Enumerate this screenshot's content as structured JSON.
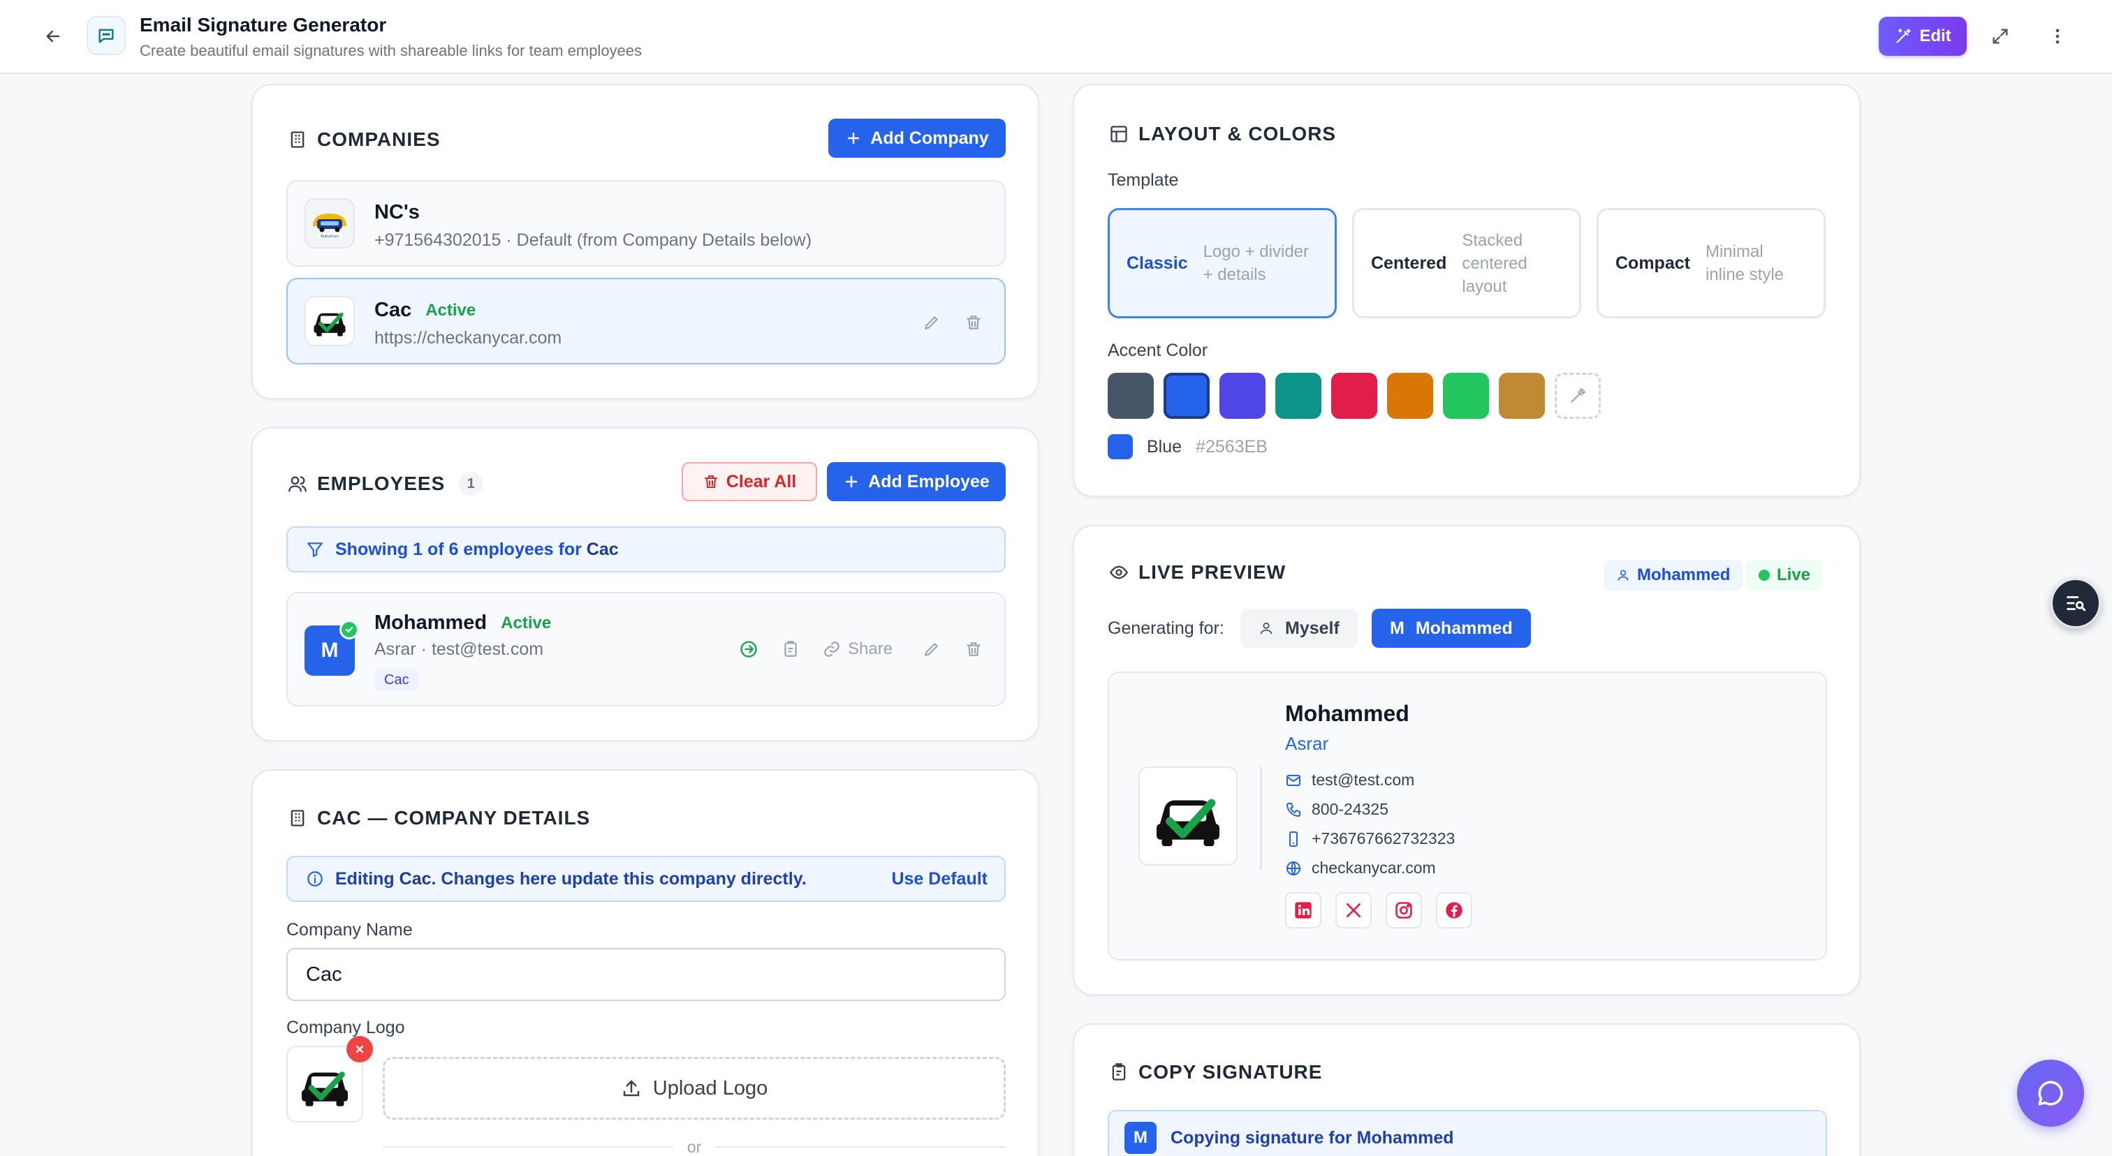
{
  "app": {
    "title": "Email Signature Generator",
    "subtitle": "Create beautiful email signatures with shareable links for team employees",
    "edit_label": "Edit"
  },
  "companies": {
    "title": "COMPANIES",
    "add_label": "Add Company",
    "items": [
      {
        "name": "NC's",
        "detail": "+971564302015 · Default (from Company Details below)",
        "logo_text": "NubiaCars"
      },
      {
        "name": "Cac",
        "status": "Active",
        "detail": "https://checkanycar.com"
      }
    ]
  },
  "employees": {
    "title": "EMPLOYEES",
    "count": "1",
    "clear_label": "Clear All",
    "add_label": "Add Employee",
    "filter_prefix": "Showing 1 of 6 employees for ",
    "filter_company": "Cac",
    "items": [
      {
        "initial": "M",
        "name": "Mohammed",
        "status": "Active",
        "detail": "Asrar · test@test.com",
        "tag": "Cac",
        "share_label": "Share"
      }
    ]
  },
  "company_details": {
    "title": "CAC — COMPANY DETAILS",
    "info_prefix": "Editing ",
    "info_company": "Cac",
    "info_suffix": ". Changes here update this company directly.",
    "use_default": "Use Default",
    "name_label": "Company Name",
    "name_value": "Cac",
    "logo_label": "Company Logo",
    "upload_label": "Upload Logo",
    "or_label": "or"
  },
  "layout": {
    "title": "LAYOUT & COLORS",
    "template_label": "Template",
    "templates": [
      {
        "name": "Classic",
        "desc1": "Logo + divider",
        "desc2": "+ details",
        "desc3": ""
      },
      {
        "name": "Centered",
        "desc1": "Stacked",
        "desc2": "centered",
        "desc3": "layout"
      },
      {
        "name": "Compact",
        "desc1": "Minimal",
        "desc2": "inline style",
        "desc3": ""
      }
    ],
    "accent_label": "Accent Color",
    "swatches": [
      "#475569",
      "#2563EB",
      "#4F46E5",
      "#0D9488",
      "#E11D48",
      "#D97706",
      "#22C55E",
      "#C08A35"
    ],
    "selected_name": "Blue",
    "selected_hex": "#2563EB"
  },
  "preview": {
    "title": "LIVE PREVIEW",
    "user_chip": "Mohammed",
    "live_chip": "Live",
    "generating_label": "Generating for:",
    "myself_label": "Myself",
    "selected_initial": "M",
    "selected_label": "Mohammed",
    "sig_name": "Mohammed",
    "sig_role": "Asrar",
    "email": "test@test.com",
    "phone": "800-24325",
    "mobile": "+736767662732323",
    "website": "checkanycar.com"
  },
  "copy": {
    "title": "COPY SIGNATURE",
    "initial": "M",
    "banner": "Copying signature for Mohammed"
  }
}
